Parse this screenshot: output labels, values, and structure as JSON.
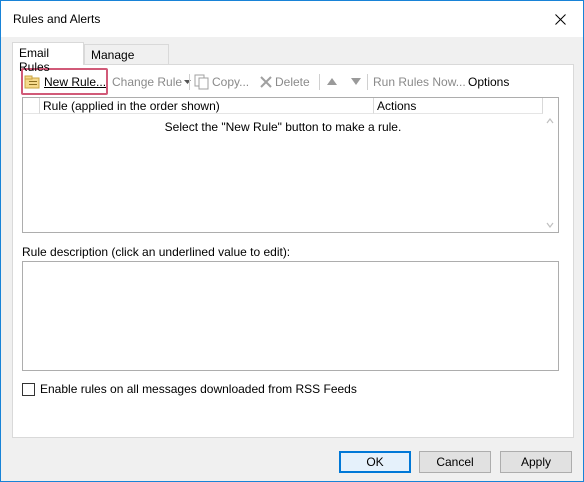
{
  "window": {
    "title": "Rules and Alerts"
  },
  "tabs": [
    {
      "label": "Email Rules",
      "active": true
    },
    {
      "label": "Manage Alerts",
      "active": false
    }
  ],
  "toolbar": {
    "new_rule": "New Rule...",
    "change_rule": "Change Rule",
    "copy": "Copy...",
    "delete": "Delete",
    "run_rules_now": "Run Rules Now...",
    "options": "Options"
  },
  "rules_list": {
    "columns": [
      "Rule (applied in the order shown)",
      "Actions"
    ],
    "empty_message": "Select the \"New Rule\" button to make a rule."
  },
  "description": {
    "label": "Rule description (click an underlined value to edit):"
  },
  "rss_checkbox": {
    "label": "Enable rules on all messages downloaded from RSS Feeds",
    "checked": false
  },
  "buttons": {
    "ok": "OK",
    "cancel": "Cancel",
    "apply": "Apply"
  },
  "colors": {
    "accent": "#0078d7",
    "highlight_frame": "#d15a78",
    "window_border": "#1883d7"
  }
}
